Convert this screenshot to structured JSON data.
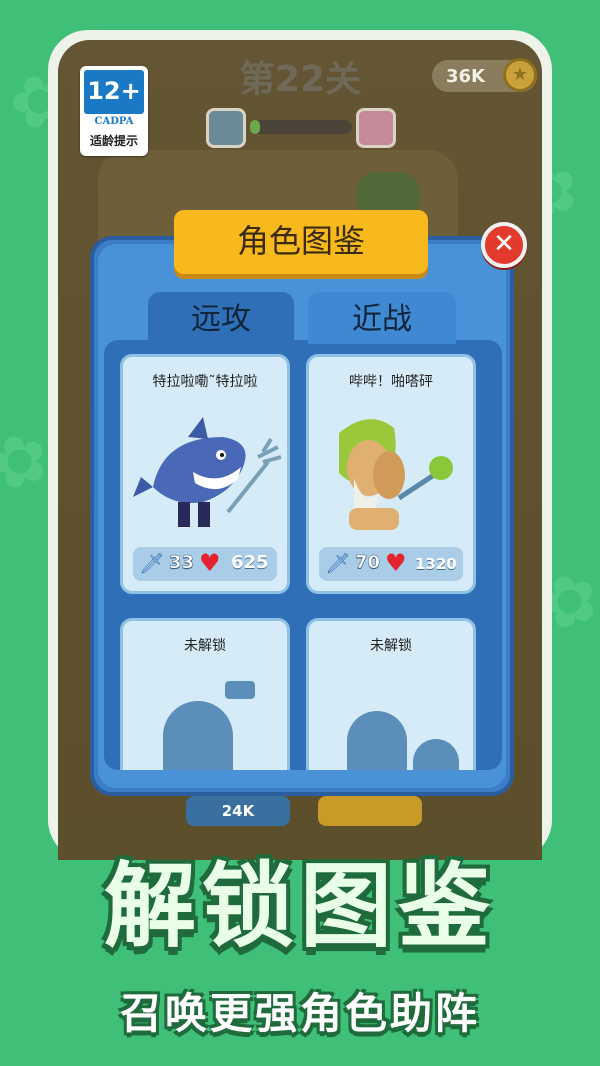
{
  "age_rating": {
    "rating": "12+",
    "org": "CADPA",
    "tip": "适龄提示"
  },
  "hud": {
    "level_title": "第22关",
    "coins": "36K",
    "coin_icon": "coin-icon",
    "progress_fraction": 0.1
  },
  "modal": {
    "title": "角色图鉴",
    "close_icon": "close-icon",
    "tabs": [
      {
        "label": "远攻"
      },
      {
        "label": "近战"
      }
    ],
    "cards": [
      {
        "name": "特拉啦嘞˜特拉啦",
        "attack": "33",
        "hp": "625",
        "unlocked": true
      },
      {
        "name": "哔哔！啪嗒砰",
        "attack": "70",
        "hp": "1320",
        "unlocked": true
      },
      {
        "name": "未解锁",
        "unlocked": false
      },
      {
        "name": "未解锁",
        "unlocked": false
      }
    ]
  },
  "background_buttons": {
    "cost": "24K"
  },
  "banner": {
    "title": "解锁图鉴",
    "subtitle": "召唤更强角色助阵"
  },
  "colors": {
    "background": "#3fbf77",
    "modal": "#4a92d8",
    "title_plate": "#f7b91c",
    "close": "#e23b2e",
    "card": "#d5ecf8"
  }
}
